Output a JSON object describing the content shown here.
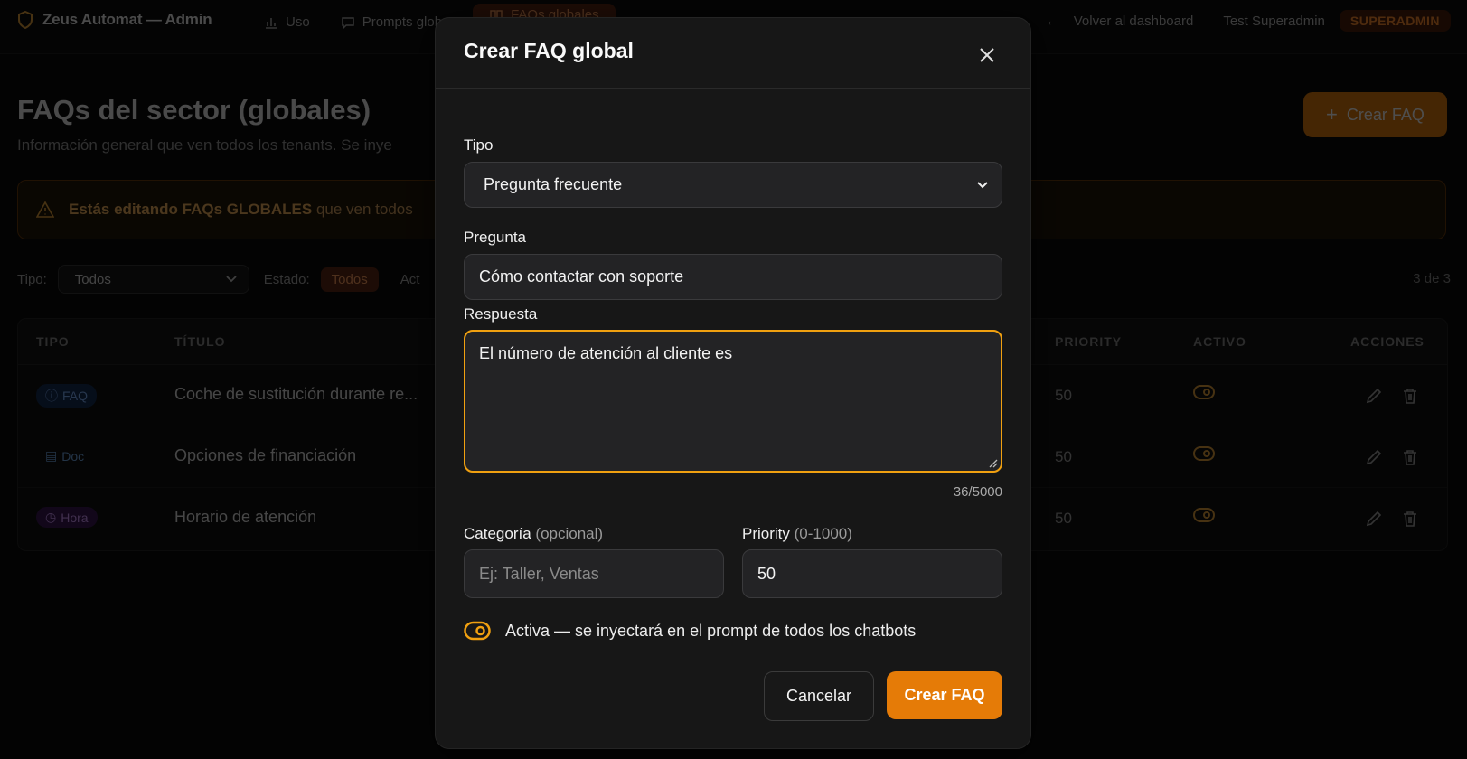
{
  "topbar": {
    "brand": "Zeus Automat — Admin",
    "nav": [
      {
        "label": "Uso"
      },
      {
        "label": "Prompts glob"
      },
      {
        "label": "FAQs globales"
      }
    ],
    "back_label": "Volver al dashboard",
    "user_name": "Test Superadmin",
    "role_badge": "SUPERADMIN"
  },
  "page": {
    "title": "FAQs del sector (globales)",
    "subtitle": "Información general que ven todos los tenants. Se inye",
    "create_button": "Crear FAQ"
  },
  "warning": {
    "bold": "Estás editando FAQs GLOBALES",
    "text": " que ven todos"
  },
  "filters": {
    "tipo_label": "Tipo:",
    "tipo_value": "Todos",
    "estado_label": "Estado:",
    "estado_value": "Todos",
    "next_label": "Act",
    "count": "3 de 3"
  },
  "table": {
    "headers": {
      "tipo": "TIPO",
      "titulo": "TÍTULO",
      "priority": "PRIORITY",
      "activo": "ACTIVO",
      "acciones": "ACCIONES"
    },
    "rows": [
      {
        "type": "FAQ",
        "title": "Coche de sustitución durante re...",
        "priority": "50"
      },
      {
        "type": "Doc",
        "title": "Opciones de financiación",
        "priority": "50"
      },
      {
        "type": "Hora",
        "title": "Horario de atención",
        "priority": "50"
      }
    ]
  },
  "modal": {
    "title": "Crear FAQ global",
    "tipo_label": "Tipo",
    "tipo_value": "Pregunta frecuente",
    "pregunta_label": "Pregunta",
    "pregunta_value": "Cómo contactar con soporte",
    "respuesta_label": "Respuesta",
    "respuesta_value": "El número de atención al cliente es",
    "char_count": "36/5000",
    "categoria_label": "Categoría",
    "categoria_hint": "(opcional)",
    "categoria_placeholder": "Ej: Taller, Ventas",
    "priority_label": "Priority",
    "priority_hint": "(0-1000)",
    "priority_value": "50",
    "activa_text": "Activa — se inyectará en el prompt de todos los chatbots",
    "cancel": "Cancelar",
    "submit": "Crear FAQ"
  },
  "colors": {
    "accent": "#e57b07",
    "focus": "#f0a010",
    "warning_border": "#6b3a07"
  }
}
